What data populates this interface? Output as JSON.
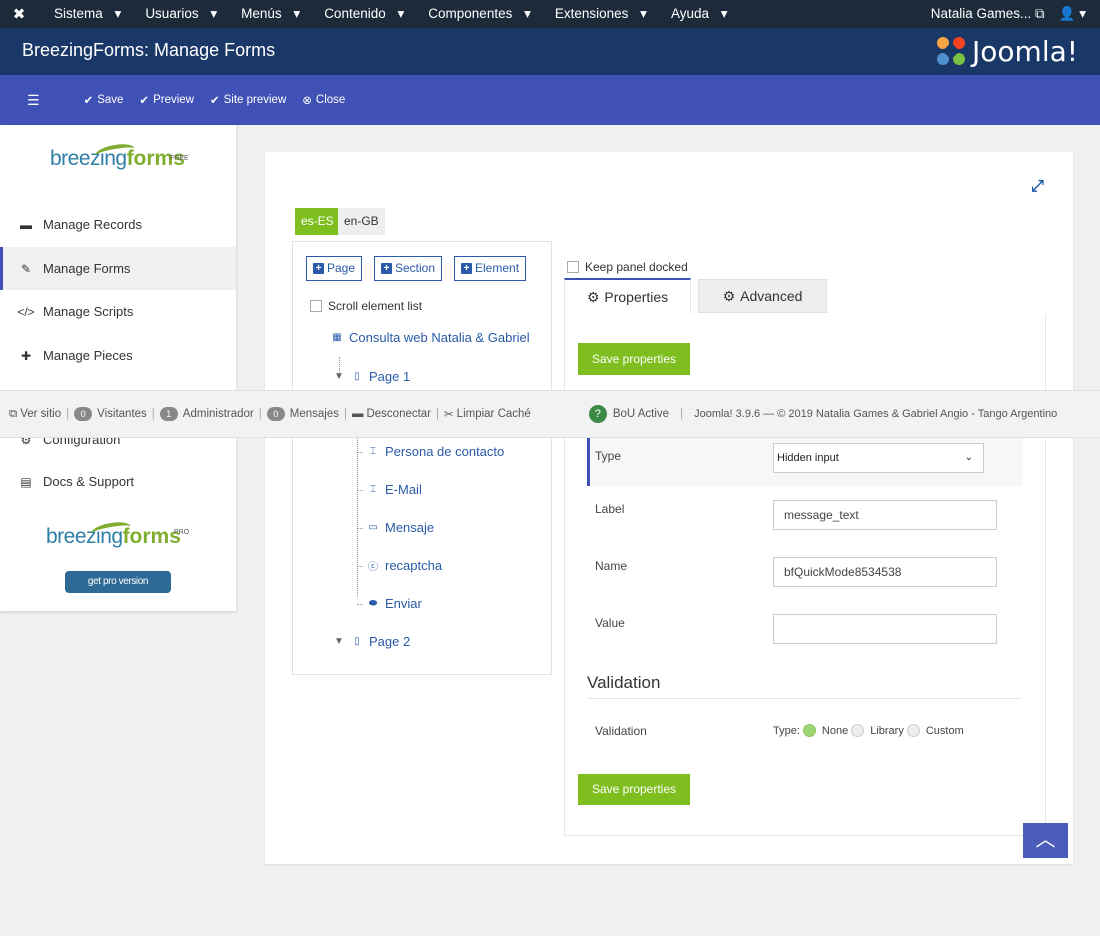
{
  "topbar": {
    "menu": [
      "Sistema",
      "Usuarios",
      "Menús",
      "Contenido",
      "Componentes",
      "Extensiones",
      "Ayuda"
    ],
    "user": "Natalia Games..."
  },
  "header": {
    "title": "BreezingForms: Manage Forms",
    "brand": "Joomla!"
  },
  "toolbar": {
    "save": "Save",
    "preview": "Preview",
    "site_preview": "Site preview",
    "close": "Close"
  },
  "sidebar": {
    "logo_brand1": "breezing",
    "logo_brand2": "forms",
    "logo_tag_free": "FREE",
    "logo_tag_pro": "PRO",
    "items": [
      "Manage Records",
      "Manage Forms",
      "Manage Scripts",
      "Manage Pieces",
      "Configuration",
      "Docs & Support"
    ],
    "get_pro": "get pro version"
  },
  "editor": {
    "langs": [
      "es-ES",
      "en-GB"
    ],
    "buttons": {
      "page": "Page",
      "section": "Section",
      "element": "Element"
    },
    "scroll_list": "Scroll element list",
    "keep_docked": "Keep panel docked",
    "tree": {
      "form": "Consulta web Natalia & Gabriel",
      "page1": "Page 1",
      "elements": [
        "Persona de contacto",
        "E-Mail",
        "Mensaje",
        "recaptcha",
        "Enviar"
      ],
      "page2": "Page 2"
    },
    "tabs": {
      "properties": "Properties",
      "advanced": "Advanced"
    },
    "save_properties": "Save properties",
    "fields": {
      "type_label": "Type",
      "type_value": "Hidden input",
      "label_label": "Label",
      "label_value": "message_text",
      "name_label": "Name",
      "name_value": "bfQuickMode8534538",
      "value_label": "Value",
      "value_value": ""
    },
    "validation": {
      "heading": "Validation",
      "label": "Validation",
      "type_label": "Type:",
      "options": [
        "None",
        "Library",
        "Custom"
      ]
    }
  },
  "statusbar": {
    "ver_sitio": "Ver sitio",
    "visitantes_count": "0",
    "visitantes": "Visitantes",
    "admin_count": "1",
    "admin": "Administrador",
    "mensajes_count": "0",
    "mensajes": "Mensajes",
    "desconectar": "Desconectar",
    "limpiar": "Limpiar Caché",
    "bou": "BoU Active",
    "footer": "Joomla! 3.9.6 — © 2019 Natalia Games & Gabriel Angio - Tango Argentino"
  }
}
